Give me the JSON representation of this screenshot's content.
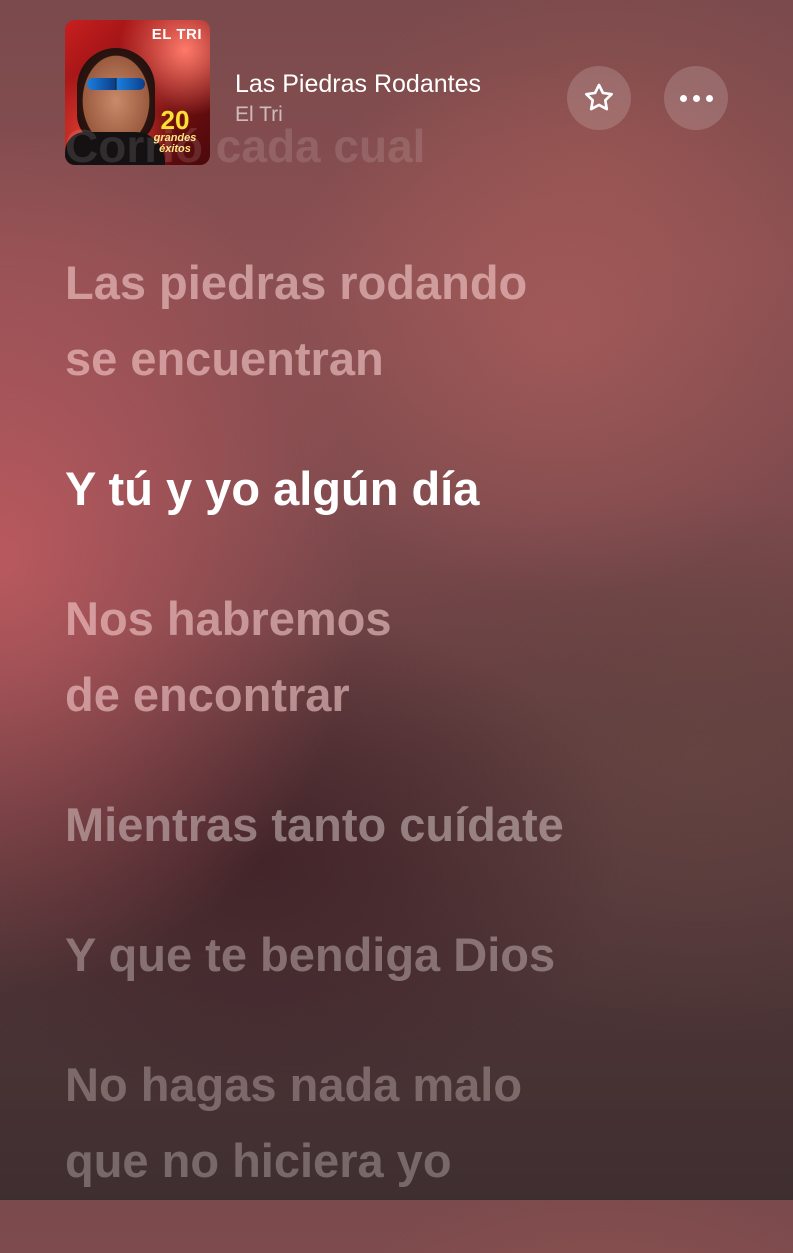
{
  "header": {
    "album_art": {
      "band_text": "EL TRI",
      "badge_number": "20",
      "badge_text": "grandes éxitos"
    },
    "song_title": "Las Piedras Rodantes",
    "artist": "El Tri",
    "favorite_icon": "star-outline-icon",
    "more_icon": "ellipsis-icon"
  },
  "lyrics": {
    "previous_partial": "Corrió cada cual",
    "lines": [
      {
        "lines": [
          "Las piedras rodando",
          "se encuentran"
        ],
        "state": "near"
      },
      {
        "lines": [
          "Y tú y yo algún día"
        ],
        "state": "active"
      },
      {
        "lines": [
          "Nos habremos",
          "de encontrar"
        ],
        "state": "near"
      },
      {
        "lines": [
          "Mientras tanto cuídate"
        ],
        "state": "far1"
      },
      {
        "lines": [
          "Y que te bendiga Dios"
        ],
        "state": "far2"
      },
      {
        "lines": [
          "No hagas nada malo",
          "que no hiciera yo"
        ],
        "state": "far3"
      }
    ]
  },
  "colors": {
    "active_lyric": "#ffffff",
    "inactive_lyric": "#e6d7d7",
    "background_top": "#7a4a4c",
    "background_bottom": "#3f2e30"
  }
}
